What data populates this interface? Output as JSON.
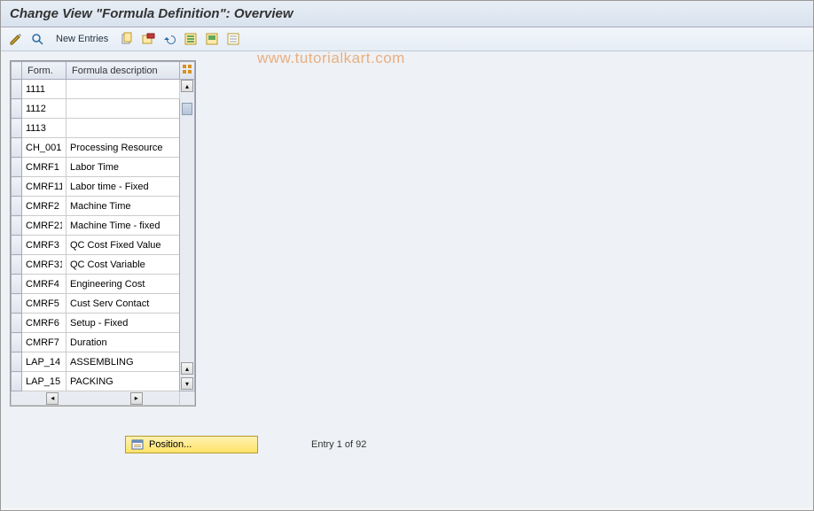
{
  "title": "Change View \"Formula Definition\": Overview",
  "toolbar": {
    "new_entries": "New Entries"
  },
  "watermark": "www.tutorialkart.com",
  "table": {
    "headers": {
      "col1": "Form.",
      "col2": "Formula description"
    },
    "rows": [
      {
        "form": "1111",
        "desc": ""
      },
      {
        "form": "1112",
        "desc": ""
      },
      {
        "form": "1113",
        "desc": ""
      },
      {
        "form": "CH_001",
        "desc": "Processing Resource"
      },
      {
        "form": "CMRF1",
        "desc": "Labor Time"
      },
      {
        "form": "CMRF11",
        "desc": "Labor time - Fixed"
      },
      {
        "form": "CMRF2",
        "desc": "Machine Time"
      },
      {
        "form": "CMRF21",
        "desc": "Machine Time - fixed"
      },
      {
        "form": "CMRF3",
        "desc": "QC Cost Fixed Value"
      },
      {
        "form": "CMRF31",
        "desc": "QC Cost Variable"
      },
      {
        "form": "CMRF4",
        "desc": "Engineering Cost"
      },
      {
        "form": "CMRF5",
        "desc": "Cust Serv Contact"
      },
      {
        "form": "CMRF6",
        "desc": "Setup - Fixed"
      },
      {
        "form": "CMRF7",
        "desc": "Duration"
      },
      {
        "form": "LAP_14",
        "desc": "ASSEMBLING"
      },
      {
        "form": "LAP_15",
        "desc": "PACKING"
      }
    ]
  },
  "footer": {
    "position_label": "Position...",
    "entry_text": "Entry 1 of 92"
  }
}
